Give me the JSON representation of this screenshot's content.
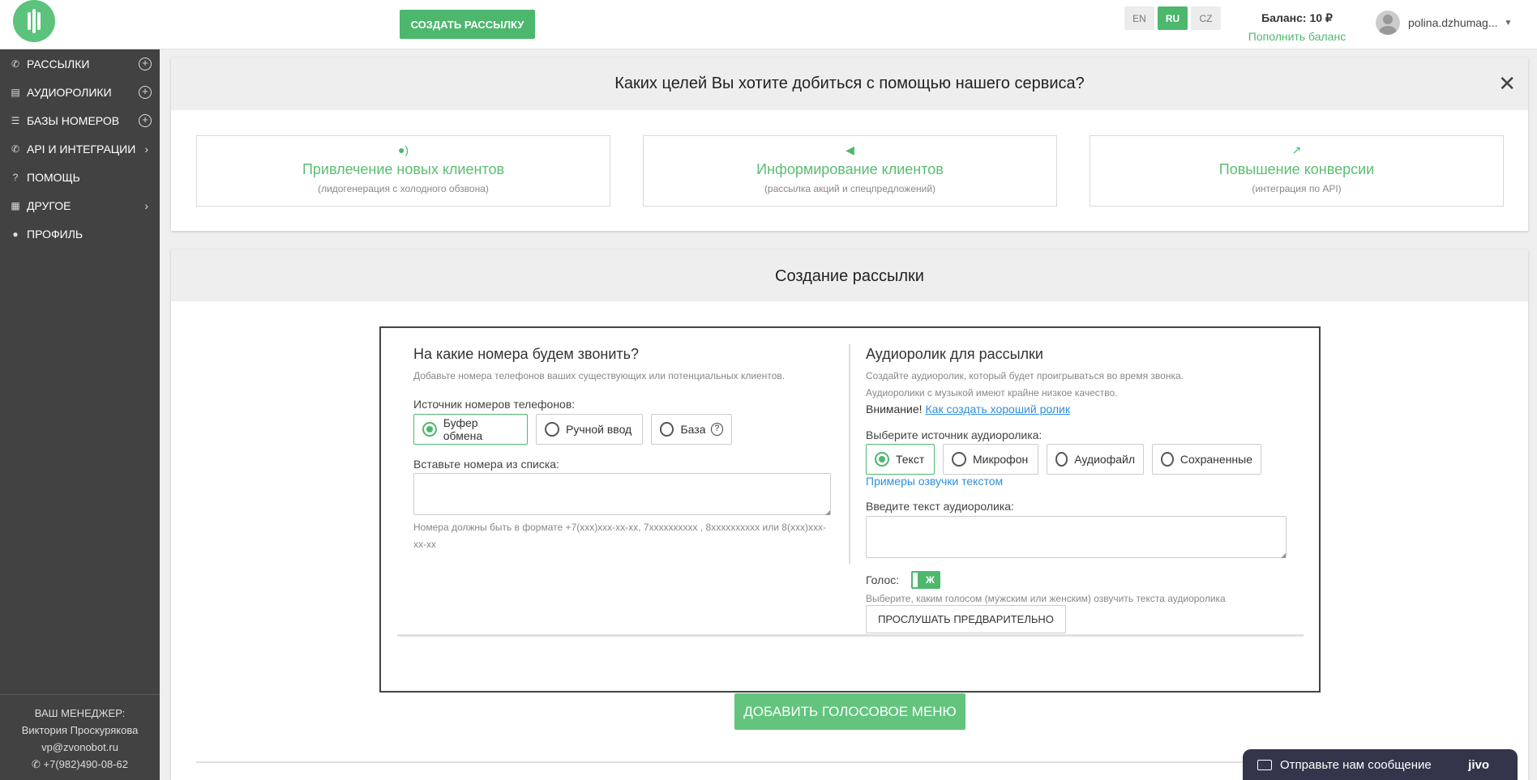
{
  "header": {
    "create_button": "СОЗДАТЬ РАССЫЛКУ",
    "languages": [
      {
        "code": "EN",
        "active": false
      },
      {
        "code": "RU",
        "active": true
      },
      {
        "code": "CZ",
        "active": false
      }
    ],
    "balance_label": "Баланс: 10 ₽",
    "topup_link": "Пополнить баланс",
    "username": "polina.dzhumag...",
    "user_menu_icon": "chevron-down-icon"
  },
  "colors": {
    "brand_green": "#4db86d",
    "sidebar_bg": "#424242",
    "link_blue": "#2f8fdc",
    "chat_bg": "#34344a"
  },
  "sidebar": {
    "items": [
      {
        "label": "РАССЫЛКИ",
        "icon": "phone-icon",
        "action": "add"
      },
      {
        "label": "АУДИОРОЛИКИ",
        "icon": "file-audio-icon",
        "action": "add"
      },
      {
        "label": "БАЗЫ НОМЕРОВ",
        "icon": "database-icon",
        "action": "add"
      },
      {
        "label": "API И ИНТЕГРАЦИИ",
        "icon": "phone-forward-icon",
        "action": "expand"
      },
      {
        "label": "ПОМОЩЬ",
        "icon": "question-icon",
        "action": ""
      },
      {
        "label": "ДРУГОЕ",
        "icon": "grid-icon",
        "action": "expand"
      },
      {
        "label": "ПРОФИЛЬ",
        "icon": "user-icon",
        "action": ""
      }
    ],
    "manager": {
      "title": "ВАШ МЕНЕДЖЕР:",
      "name": "Виктория Проскурякова",
      "email": "vp@zvonobot.ru",
      "phone": "+7(982)490-08-62"
    }
  },
  "goals": {
    "title": "Каких целей Вы хотите добиться с помощью нашего сервиса?",
    "cards": [
      {
        "icon": "users-sound-icon",
        "title": "Привлечение новых клиентов",
        "subtitle": "(лидогенерация с холодного обзвона)"
      },
      {
        "icon": "megaphone-icon",
        "title": "Информирование клиентов",
        "subtitle": "(рассылка акций и спецпредложений)"
      },
      {
        "icon": "chart-up-icon",
        "title": "Повышение конверсии",
        "subtitle": "(интеграция по API)"
      }
    ]
  },
  "create": {
    "title": "Создание рассылки",
    "numbers": {
      "title": "На какие номера будем звонить?",
      "hint": "Добавьте номера телефонов ваших существующих или потенциальных клиентов.",
      "source_label": "Источник номеров телефонов:",
      "options": [
        "Буфер обмена",
        "Ручной ввод",
        "База"
      ],
      "selected": 0,
      "paste_label": "Вставьте номера из списка:",
      "paste_value": "",
      "format_hint": "Номера должны быть в формате +7(xxx)xxx-xx-xx, 7xxxxxxxxxx , 8xxxxxxxxxx или 8(xxx)xxx-xx-xx"
    },
    "audio": {
      "title": "Аудиоролик для рассылки",
      "hint1": "Создайте аудиоролик, который будет проигрываться во время звонка.",
      "hint2": "Аудиоролики с музыкой имеют крайне низкое качество.",
      "warning_label": "Внимание!",
      "warning_link": "Как создать хороший ролик",
      "source_label": "Выберите источник аудиоролика:",
      "options": [
        "Текст",
        "Микрофон",
        "Аудиофайл",
        "Сохраненные"
      ],
      "selected": 0,
      "examples_link": "Примеры озвучки текстом",
      "text_label": "Введите текст аудиоролика:",
      "text_value": "",
      "voice_label": "Голос:",
      "voice_value": "Ж",
      "voice_hint": "Выберите, каким голосом (мужским или женским) озвучить текста аудиоролика",
      "preview_button": "ПРОСЛУШАТЬ ПРЕДВАРИТЕЛЬНО"
    },
    "add_voice_menu_button": "ДОБАВИТЬ ГОЛОСОВОЕ МЕНЮ"
  },
  "chat": {
    "label": "Отправьте нам сообщение",
    "brand": "jivo"
  }
}
